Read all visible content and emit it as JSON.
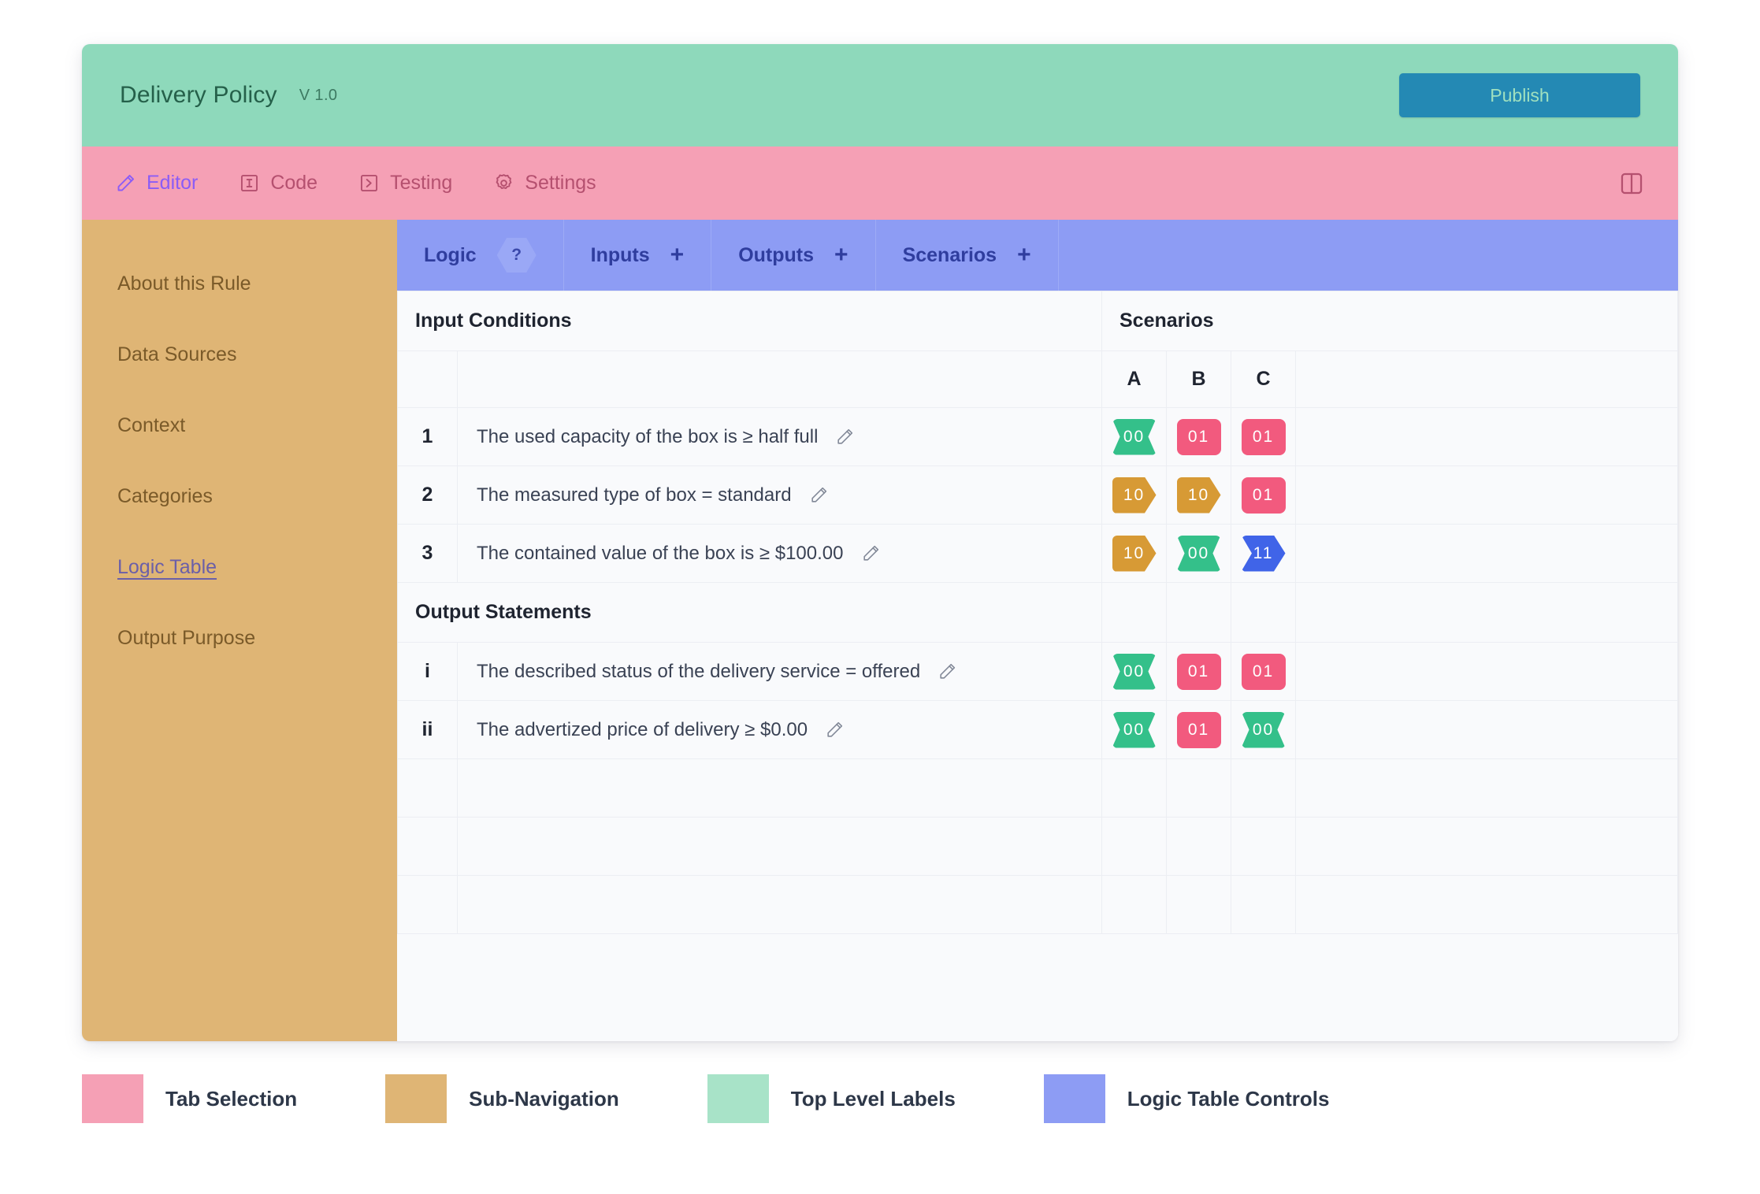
{
  "header": {
    "title": "Delivery Policy",
    "version": "V 1.0",
    "publish_label": "Publish",
    "bg_color": "#8ed9bb",
    "publish_color": "#2489b4"
  },
  "tabbar": {
    "bg_color": "#f5a0b5",
    "active_color": "#8b5cf6",
    "tabs": [
      {
        "label": "Editor",
        "icon": "pencil-icon",
        "active": true
      },
      {
        "label": "Code",
        "icon": "text-cursor-icon",
        "active": false
      },
      {
        "label": "Testing",
        "icon": "play-box-icon",
        "active": false
      },
      {
        "label": "Settings",
        "icon": "gear-icon",
        "active": false
      }
    ],
    "panel_toggle_icon": "split-panel-icon"
  },
  "sidebar": {
    "bg_color": "#dfb575",
    "items": [
      {
        "label": "About this Rule",
        "active": false
      },
      {
        "label": "Data Sources",
        "active": false
      },
      {
        "label": "Context",
        "active": false
      },
      {
        "label": "Categories",
        "active": false
      },
      {
        "label": "Logic Table",
        "active": true
      },
      {
        "label": "Output Purpose",
        "active": false
      }
    ]
  },
  "logic_tabs": {
    "bg_color": "#8d9cf4",
    "items": [
      {
        "label": "Logic",
        "badge": "?",
        "badge_shape": "hexagon"
      },
      {
        "label": "Inputs",
        "action": "+"
      },
      {
        "label": "Outputs",
        "action": "+"
      },
      {
        "label": "Scenarios",
        "action": "+"
      }
    ]
  },
  "logic_table": {
    "input_section_label": "Input Conditions",
    "scenarios_label": "Scenarios",
    "output_section_label": "Output Statements",
    "scenario_columns": [
      "A",
      "B",
      "C"
    ],
    "input_rows": [
      {
        "num": "1",
        "text": "The used capacity of the box is ≥ half full",
        "edit_icon": "pencil-icon",
        "cells": [
          {
            "value": "00",
            "color": "#34c08a",
            "shape": "bowtie"
          },
          {
            "value": "01",
            "color": "#f25a7e",
            "shape": "rect"
          },
          {
            "value": "01",
            "color": "#f25a7e",
            "shape": "rect"
          }
        ]
      },
      {
        "num": "2",
        "text": "The measured type of box = standard",
        "edit_icon": "pencil-icon",
        "cells": [
          {
            "value": "10",
            "color": "#d79a35",
            "shape": "hexagon"
          },
          {
            "value": "10",
            "color": "#d79a35",
            "shape": "hexagon"
          },
          {
            "value": "01",
            "color": "#f25a7e",
            "shape": "rect"
          }
        ]
      },
      {
        "num": "3",
        "text": "The contained value of the box is ≥ $100.00",
        "edit_icon": "pencil-icon",
        "cells": [
          {
            "value": "10",
            "color": "#d79a35",
            "shape": "hexagon"
          },
          {
            "value": "00",
            "color": "#34c08a",
            "shape": "bowtie"
          },
          {
            "value": "11",
            "color": "#4064e8",
            "shape": "chevron"
          }
        ]
      }
    ],
    "output_rows": [
      {
        "num": "i",
        "text": "The described status of the delivery service = offered",
        "edit_icon": "pencil-icon",
        "cells": [
          {
            "value": "00",
            "color": "#34c08a",
            "shape": "bowtie"
          },
          {
            "value": "01",
            "color": "#f25a7e",
            "shape": "rect"
          },
          {
            "value": "01",
            "color": "#f25a7e",
            "shape": "rect"
          }
        ]
      },
      {
        "num": "ii",
        "text": "The advertized price of delivery ≥ $0.00",
        "edit_icon": "pencil-icon",
        "cells": [
          {
            "value": "00",
            "color": "#34c08a",
            "shape": "bowtie"
          },
          {
            "value": "01",
            "color": "#f25a7e",
            "shape": "rect"
          },
          {
            "value": "00",
            "color": "#34c08a",
            "shape": "bowtie"
          }
        ]
      }
    ],
    "empty_row_count": 3
  },
  "legend": [
    {
      "label": "Tab Selection",
      "color": "#f5a0b5"
    },
    {
      "label": "Sub-Navigation",
      "color": "#dfb575"
    },
    {
      "label": "Top Level Labels",
      "color": "#a8e3c8"
    },
    {
      "label": "Logic Table Controls",
      "color": "#8d9cf4"
    }
  ]
}
